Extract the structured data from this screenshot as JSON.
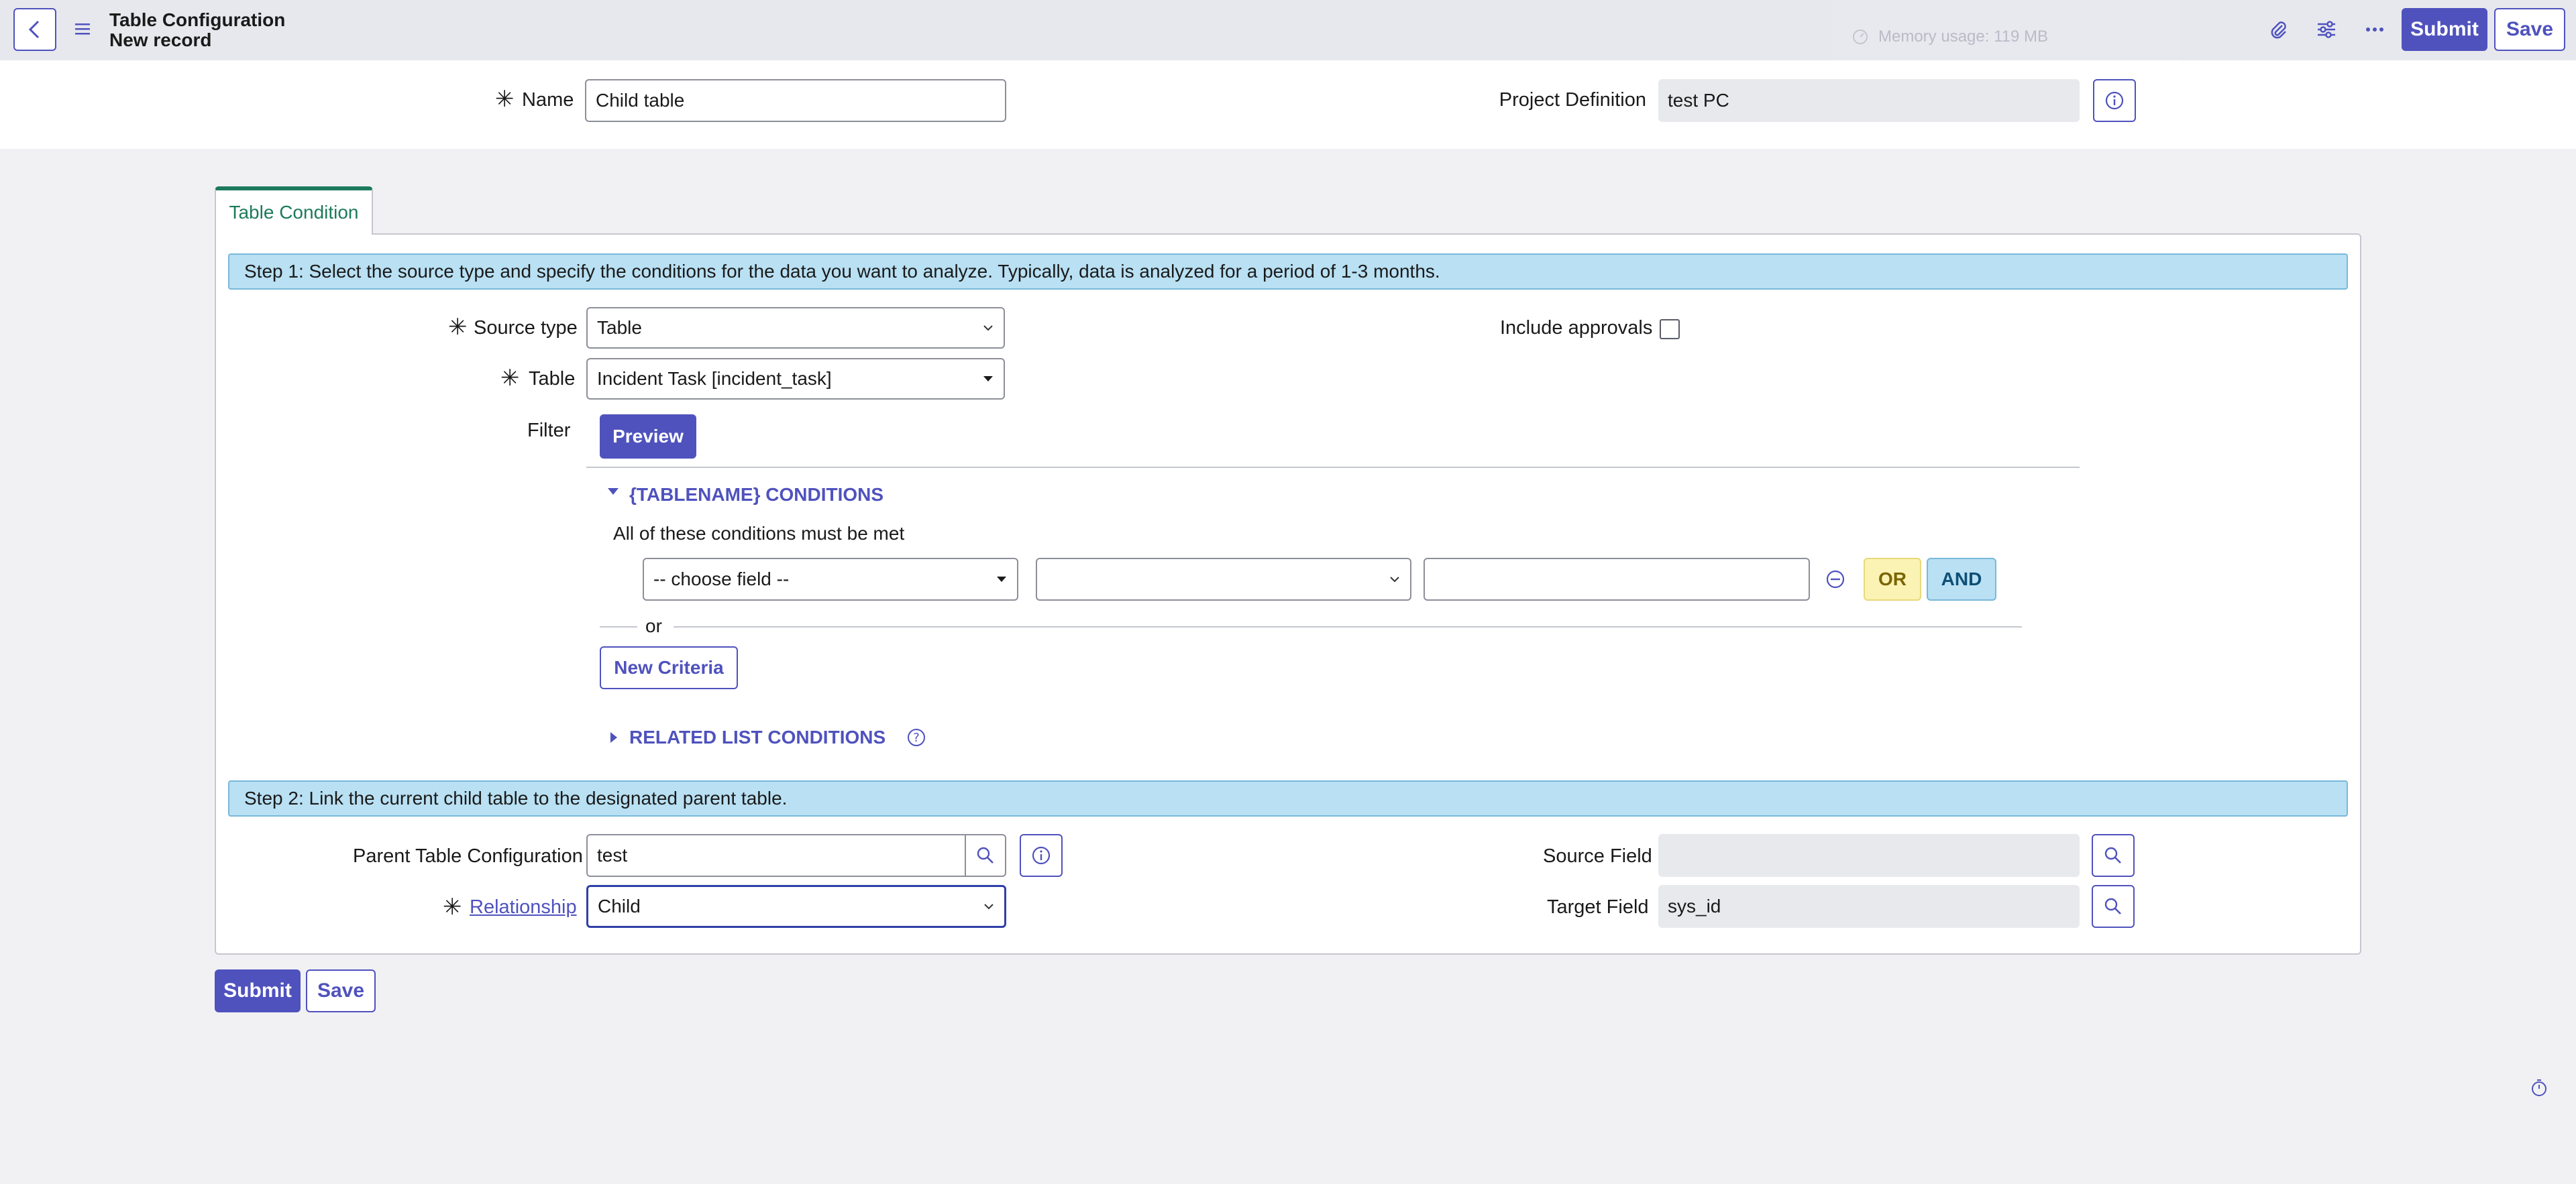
{
  "header": {
    "title": "Table Configuration",
    "subtitle": "New record",
    "memory": "Memory usage: 119 MB",
    "submit_label": "Submit",
    "save_label": "Save",
    "icons": [
      "back-icon",
      "menu-icon",
      "attachment-icon",
      "settings-icon",
      "more-icon"
    ]
  },
  "top_form": {
    "name_label": "Name",
    "name_value": "Child table",
    "project_label": "Project Definition",
    "project_value": "test PC"
  },
  "tab": {
    "label": "Table Condition"
  },
  "step1": {
    "text": "Step 1: Select the source type and specify the conditions for the data you want to analyze. Typically, data is analyzed for a period of 1-3 months.",
    "source_type_label": "Source type",
    "source_type_value": "Table",
    "table_label": "Table",
    "table_value": "Incident Task [incident_task]",
    "include_approvals_label": "Include approvals",
    "include_approvals_checked": false,
    "filter_label": "Filter",
    "preview_label": "Preview",
    "conditions_header": "{TABLENAME} CONDITIONS",
    "conditions_subtitle": "All of these conditions must be met",
    "choose_field": "-- choose field --",
    "operator_value": "",
    "value_value": "",
    "or_label": "OR",
    "and_label": "AND",
    "or_divider": "or",
    "new_criteria_label": "New Criteria",
    "related_list_label": "RELATED LIST CONDITIONS"
  },
  "step2": {
    "text": "Step 2: Link the current child table to the designated parent table.",
    "parent_label": "Parent Table Configuration",
    "parent_value": "test",
    "relationship_label": "Relationship",
    "relationship_value": "Child",
    "source_field_label": "Source Field",
    "source_field_value": "",
    "target_field_label": "Target Field",
    "target_field_value": "sys_id"
  },
  "footer": {
    "submit_label": "Submit",
    "save_label": "Save"
  },
  "colors": {
    "accent": "#4f52bd",
    "tab_green": "#1d7a5c",
    "step_bar": "#b9e0f3",
    "or": "#fbf3b4",
    "and": "#b9e0f3"
  }
}
